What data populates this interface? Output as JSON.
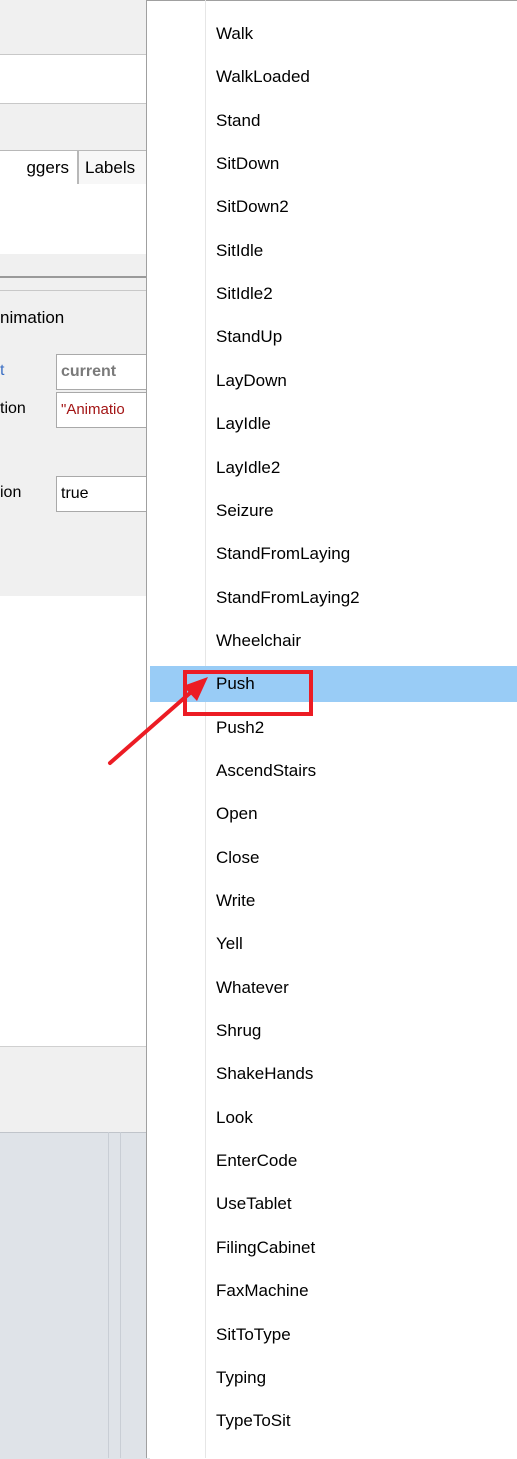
{
  "background_window": {
    "tabs": {
      "triggers": "ggers",
      "labels": "Labels"
    },
    "properties": {
      "heading": "nimation",
      "rows": [
        {
          "label": "t",
          "value": "current"
        },
        {
          "label": "tion",
          "value": "\"Animatio"
        },
        {
          "label": "ion",
          "value": "true"
        }
      ]
    }
  },
  "dropdown": {
    "selected": "Push",
    "items": [
      "Walk",
      "WalkLoaded",
      "Stand",
      "SitDown",
      "SitDown2",
      "SitIdle",
      "SitIdle2",
      "StandUp",
      "LayDown",
      "LayIdle",
      "LayIdle2",
      "Seizure",
      "StandFromLaying",
      "StandFromLaying2",
      "Wheelchair",
      "Push",
      "Push2",
      "AscendStairs",
      "Open",
      "Close",
      "Write",
      "Yell",
      "Whatever",
      "Shrug",
      "ShakeHands",
      "Look",
      "EnterCode",
      "UseTablet",
      "FilingCabinet",
      "FaxMachine",
      "SitToType",
      "Typing",
      "TypeToSit"
    ]
  },
  "colors": {
    "selection": "#99ccf6",
    "annotation_red": "#ec1c24"
  }
}
